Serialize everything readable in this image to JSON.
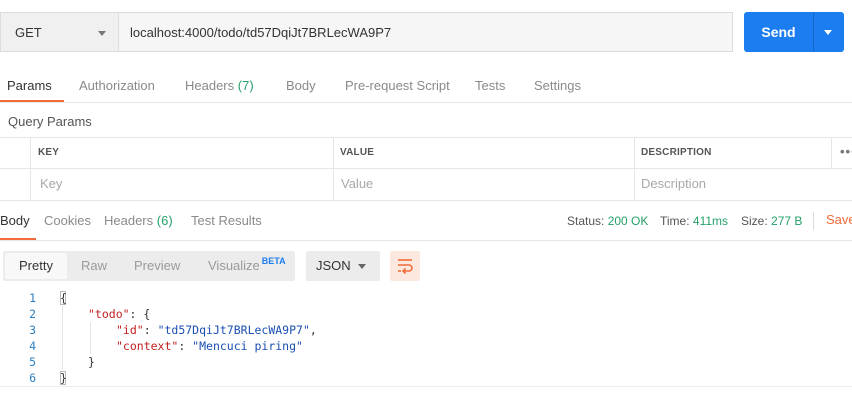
{
  "request": {
    "method": "GET",
    "url": "localhost:4000/todo/td57DqiJt7BRLecWA9P7",
    "send_label": "Send"
  },
  "request_tabs": [
    {
      "label": "Params",
      "count": ""
    },
    {
      "label": "Authorization",
      "count": ""
    },
    {
      "label": "Headers",
      "count": "(7)"
    },
    {
      "label": "Body",
      "count": ""
    },
    {
      "label": "Pre-request Script",
      "count": ""
    },
    {
      "label": "Tests",
      "count": ""
    },
    {
      "label": "Settings",
      "count": ""
    }
  ],
  "query_params": {
    "title": "Query Params",
    "headers": [
      "KEY",
      "VALUE",
      "DESCRIPTION"
    ],
    "placeholders": [
      "Key",
      "Value",
      "Description"
    ],
    "more": "•••"
  },
  "response_tabs": [
    {
      "label": "Body",
      "count": ""
    },
    {
      "label": "Cookies",
      "count": ""
    },
    {
      "label": "Headers",
      "count": "(6)"
    },
    {
      "label": "Test Results",
      "count": ""
    }
  ],
  "response_meta": {
    "status_label": "Status:",
    "status_value": "200 OK",
    "time_label": "Time:",
    "time_value": "411ms",
    "size_label": "Size:",
    "size_value": "277 B",
    "save_label": "Save"
  },
  "format_bar": {
    "buttons": [
      "Pretty",
      "Raw",
      "Preview",
      "Visualize"
    ],
    "beta": "BETA",
    "language": "JSON"
  },
  "code": {
    "line_numbers": [
      "1",
      "2",
      "3",
      "4",
      "5",
      "6"
    ],
    "open_brace": "{",
    "todo_key": "\"todo\"",
    "todo_sep": ": {",
    "id_key": "\"id\"",
    "id_value": "\"td57DqiJt7BRLecWA9P7\"",
    "context_key": "\"context\"",
    "context_value": "\"Mencuci piring\"",
    "inner_close": "}",
    "outer_close": "}"
  },
  "colors": {
    "accent": "#f26b3a",
    "primary": "#1b7df0",
    "success": "#26a069"
  }
}
